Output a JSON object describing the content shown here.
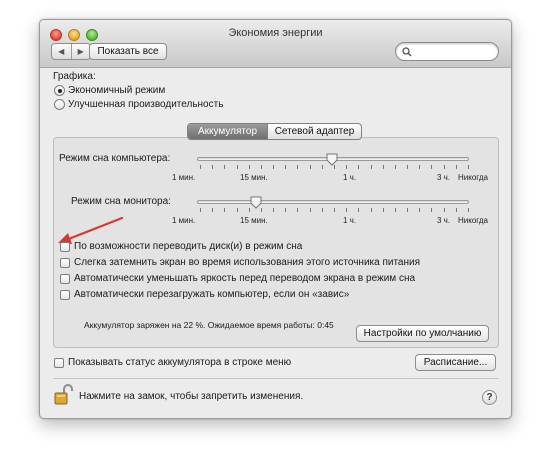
{
  "window": {
    "title": "Экономия энергии"
  },
  "toolbar": {
    "back_icon": "back-arrow-icon",
    "forward_icon": "forward-arrow-icon",
    "show_all_label": "Показать все",
    "search_placeholder": ""
  },
  "graphics": {
    "label": "Графика:",
    "options": [
      {
        "label": "Экономичный режим",
        "selected": true
      },
      {
        "label": "Улучшенная производительность",
        "selected": false
      }
    ]
  },
  "tabs": [
    {
      "label": "Аккумулятор",
      "active": true
    },
    {
      "label": "Сетевой адаптер",
      "active": false
    }
  ],
  "sliders": [
    {
      "label": "Режим сна компьютера:",
      "value_label": "1 ч.",
      "position": 0.6
    },
    {
      "label": "Режим сна монитора:",
      "value_label": "15 мин.",
      "position": 0.2
    }
  ],
  "tick_labels": [
    "1 мин.",
    "15 мин.",
    "1 ч.",
    "3 ч.",
    "Никогда"
  ],
  "options": [
    {
      "label": "По возможности переводить диск(и) в режим сна",
      "checked": false
    },
    {
      "label": "Слегка затемнить экран во время использования этого источника питания",
      "checked": false
    },
    {
      "label": "Автоматически уменьшать яркость перед переводом экрана в режим сна",
      "checked": false
    },
    {
      "label": "Автоматически перезагружать компьютер, если он «завис»",
      "checked": false
    }
  ],
  "battery_status": "Аккумулятор заряжен на 22 %. Ожидаемое время работы: 0:45",
  "defaults_button": "Настройки по умолчанию",
  "show_status": {
    "label": "Показывать статус аккумулятора в строке меню",
    "checked": false
  },
  "schedule_button": "Расписание...",
  "lock": {
    "icon": "lock-icon",
    "text": "Нажмите на замок, чтобы запретить изменения."
  },
  "help_label": "?",
  "colors": {
    "annotation_arrow": "#d63a2f"
  }
}
